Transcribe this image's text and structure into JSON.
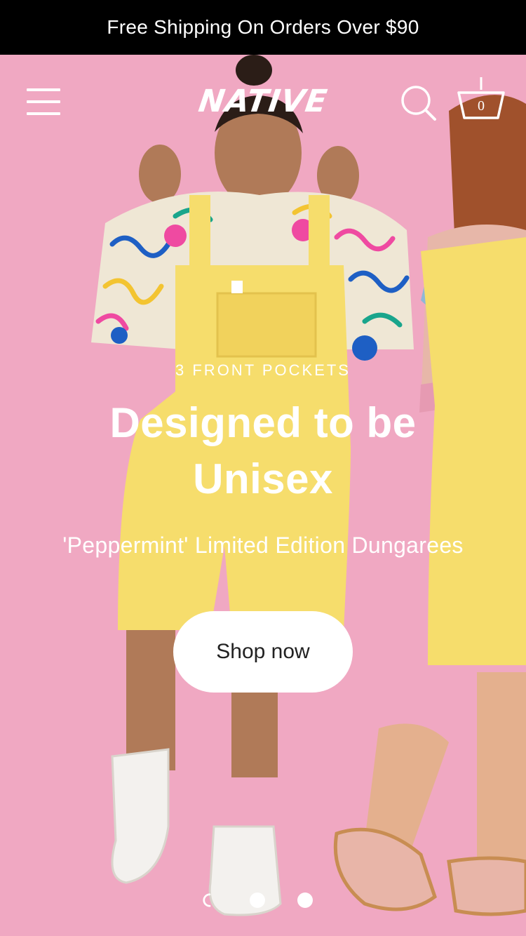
{
  "announcement": {
    "text": "Free Shipping On Orders Over $90"
  },
  "header": {
    "logo_text": "NATIVE",
    "cart_count": "0"
  },
  "hero": {
    "eyebrow": "3 FRONT POCKETS",
    "headline_line1": "Designed to be",
    "headline_line2": "Unisex",
    "subheadline": "'Peppermint' Limited Edition Dungarees",
    "cta_label": "Shop now"
  },
  "slideshow": {
    "slide_count": 3,
    "active_slide": 1
  },
  "colors": {
    "announcement_bg": "#000000",
    "hero_bg": "#f0a8c2",
    "dungaree_yellow": "#f6dd6c",
    "button_bg": "#ffffff"
  },
  "icons": [
    "menu-icon",
    "search-icon",
    "cart-icon"
  ]
}
